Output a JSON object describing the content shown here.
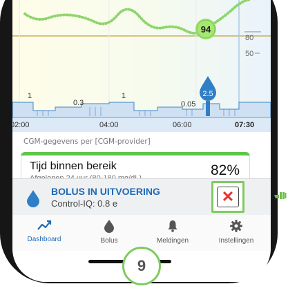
{
  "chart": {
    "glucose_badge": "94",
    "y_ticks": [
      "80",
      "50"
    ],
    "insulin_labels": [
      "1",
      "0.3",
      "1",
      "0.05"
    ],
    "bolus_marker": "2.5",
    "time_labels": [
      "02:00",
      "04:00",
      "06:00",
      "07:30"
    ]
  },
  "cgm_source": "CGM-gegevens per [CGM-provider]",
  "tir": {
    "title": "Tijd binnen bereik",
    "subtitle": "Afgelopen 24 uur (80-180 mg/dL)",
    "value": "82%",
    "color": "#5fc64b"
  },
  "bolus": {
    "title": "BOLUS IN UITVOERING",
    "subtitle": "Control-IQ: 0.8 e",
    "cancel_symbol": "✕",
    "title_color": "#1f69b5",
    "cancel_color": "#e0332a"
  },
  "nav": {
    "items": [
      {
        "label": "Dashboard",
        "icon": "chart-trend-icon"
      },
      {
        "label": "Bolus",
        "icon": "drop-icon"
      },
      {
        "label": "Meldingen",
        "icon": "bell-icon"
      },
      {
        "label": "Instellingen",
        "icon": "gear-icon"
      }
    ],
    "active_color": "#1f69b5"
  },
  "step_badge": "9",
  "highlight_color": "#7ecb60"
}
